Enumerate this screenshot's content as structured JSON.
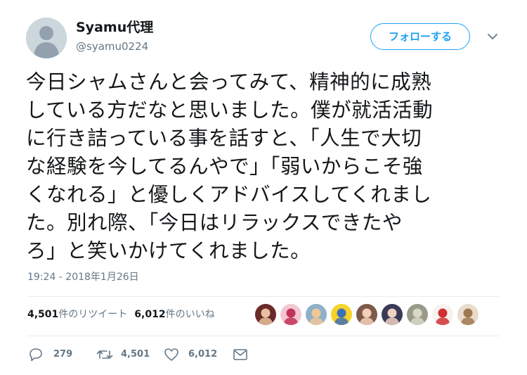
{
  "user": {
    "display_name": "Syamu代理",
    "screen_name": "@syamu0224",
    "avatar_icon": "default-avatar-icon"
  },
  "follow_button_label": "フォローする",
  "caret_icon": "chevron-down-icon",
  "tweet": {
    "lines": [
      "今日シャムさんと会ってみて、精神的に成熟",
      "している方だなと思いました。僕が就活活動",
      "に行き詰っている事を話すと、「人生で大切",
      "な経験を今してるんやで」「弱いからこそ強",
      "くなれる」と優しくアドバイスしてくれまし",
      "た。別れ際、「今日はリラックスできたや",
      "ろ」と笑いかけてくれました。"
    ],
    "timestamp": "19:24 - 2018年1月26日"
  },
  "stats": {
    "retweets_count": "4,501",
    "retweets_label": "件のリツイート",
    "likes_count": "6,012",
    "likes_label": "件のいいね"
  },
  "likers": [
    {
      "color": "#6b2a2a",
      "accent": "#e8c2a0"
    },
    {
      "color": "#f3c6d2",
      "accent": "#c0335a"
    },
    {
      "color": "#8fb0c8",
      "accent": "#f0c898"
    },
    {
      "color": "#f5d32a",
      "accent": "#3f6fb5"
    },
    {
      "color": "#7d5a4a",
      "accent": "#f4d0b8"
    },
    {
      "color": "#3a3a58",
      "accent": "#f0d0c0"
    },
    {
      "color": "#9a9a8a",
      "accent": "#d8d8c8"
    },
    {
      "color": "#f7f2ee",
      "accent": "#d03030"
    },
    {
      "color": "#e8dccc",
      "accent": "#a07850"
    }
  ],
  "actions": {
    "reply_count": "279",
    "retweet_count": "4,501",
    "like_count": "6,012",
    "reply_icon": "reply-icon",
    "retweet_icon": "retweet-icon",
    "like_icon": "heart-icon",
    "dm_icon": "envelope-icon"
  },
  "colors": {
    "accent": "#1da1f2",
    "secondary_text": "#657786",
    "primary_text": "#14171a",
    "divider": "#e6ecf0"
  }
}
